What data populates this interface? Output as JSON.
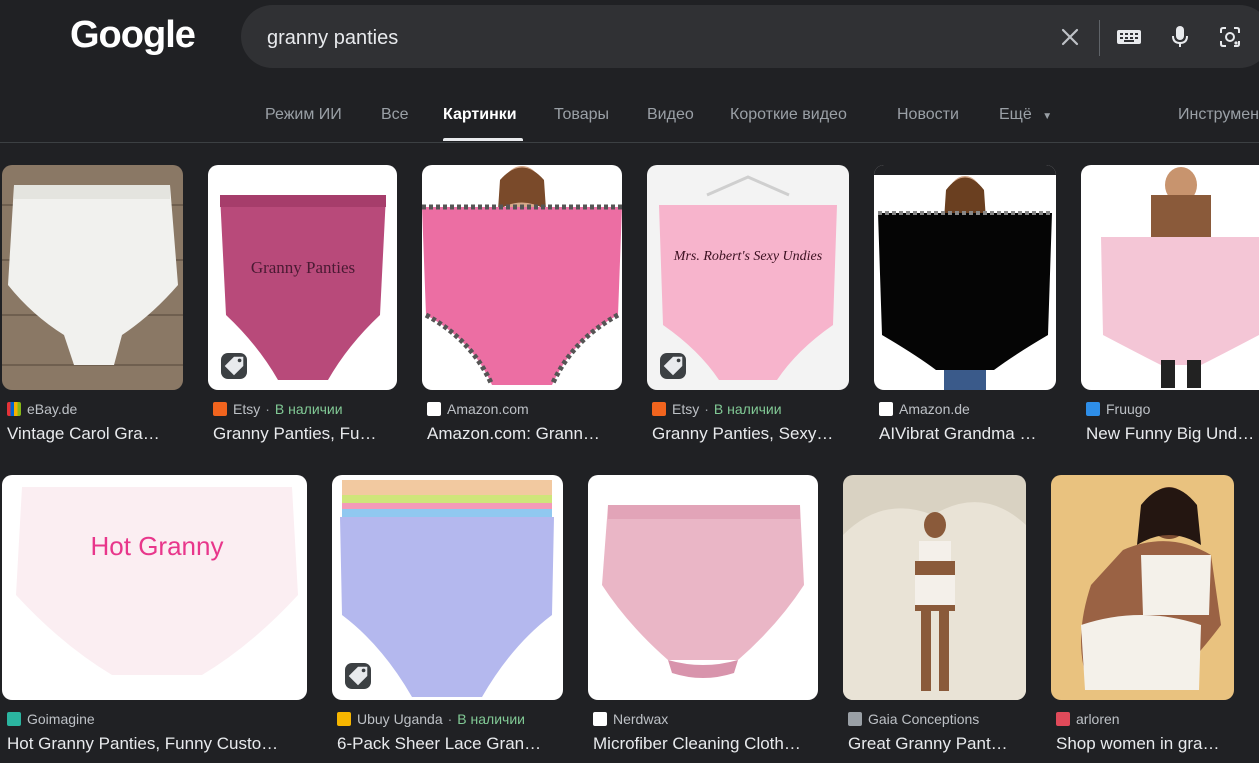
{
  "logo": "Google",
  "search": {
    "query": "granny panties"
  },
  "icons": {
    "clear": "close-icon",
    "keyboard": "keyboard-icon",
    "voice": "microphone-icon",
    "lens": "lens-camera-icon"
  },
  "tabs": [
    {
      "label": "Режим ИИ"
    },
    {
      "label": "Все"
    },
    {
      "label": "Картинки"
    },
    {
      "label": "Товары"
    },
    {
      "label": "Видео"
    },
    {
      "label": "Короткие видео"
    },
    {
      "label": "Новости"
    },
    {
      "label": "Ещё"
    },
    {
      "label": "Инструменты"
    }
  ],
  "active_tab": "Картинки",
  "results": [
    {
      "source": "eBay.de",
      "availability": "",
      "title": "Vintage Carol Gra…",
      "caption": "",
      "tagged": false,
      "favicon_color": "#e53238"
    },
    {
      "source": "Etsy",
      "availability": "В наличии",
      "title": "Granny Panties, Fu…",
      "caption": "Granny Panties",
      "tagged": true,
      "favicon_color": "#f1641e"
    },
    {
      "source": "Amazon.com",
      "availability": "",
      "title": "Amazon.com: Grann…",
      "caption": "",
      "tagged": false,
      "favicon_color": "#ffffff"
    },
    {
      "source": "Etsy",
      "availability": "В наличии",
      "title": "Granny Panties, Sexy…",
      "caption": "Mrs. Robert's Sexy Undies",
      "tagged": true,
      "favicon_color": "#f1641e"
    },
    {
      "source": "Amazon.de",
      "availability": "",
      "title": "AIVibrat Grandma …",
      "caption": "",
      "tagged": false,
      "favicon_color": "#ffffff"
    },
    {
      "source": "Fruugo",
      "availability": "",
      "title": "New Funny Big Unde…",
      "caption": "",
      "tagged": false,
      "favicon_color": "#2e8ee8"
    },
    {
      "source": "Goimagine",
      "availability": "",
      "title": "Hot Granny Panties, Funny Custo…",
      "caption": "Hot Granny",
      "tagged": false,
      "favicon_color": "#2bb5a0"
    },
    {
      "source": "Ubuy Uganda",
      "availability": "В наличии",
      "title": "6-Pack Sheer Lace Gran…",
      "caption": "",
      "tagged": true,
      "favicon_color": "#f7b600"
    },
    {
      "source": "Nerdwax",
      "availability": "",
      "title": "Microfiber Cleaning Cloth…",
      "caption": "",
      "tagged": false,
      "favicon_color": "#ffffff"
    },
    {
      "source": "Gaia Conceptions",
      "availability": "",
      "title": "Great Granny Pant…",
      "caption": "",
      "tagged": false,
      "favicon_color": "#9aa0a6"
    },
    {
      "source": "arloren",
      "availability": "",
      "title": "Shop women in gra…",
      "caption": "",
      "tagged": false,
      "favicon_color": "#e04a5a"
    }
  ]
}
